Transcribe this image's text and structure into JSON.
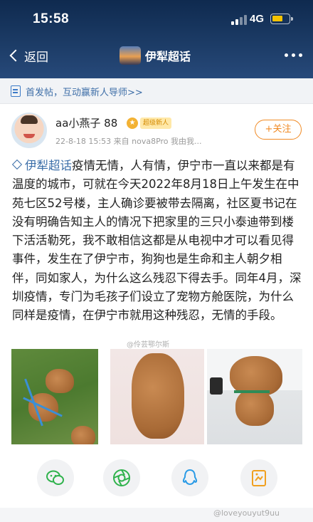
{
  "status_bar": {
    "time": "15:58",
    "network": "4G"
  },
  "nav": {
    "back_label": "返回",
    "title": "伊犁超话"
  },
  "guide": {
    "text": "首发帖，互动赢新人导师>>"
  },
  "post": {
    "username": "aa小燕子 88",
    "badge_fan": "超级新人",
    "meta": "22-8-18 15:53  来自 nova8Pro 我由我...",
    "follow_label": "+关注",
    "topic_tag": "伊犁超话",
    "body": "疫情无情，人有情，伊宁市一直以来都是有温度的城市，可就在今天2022年8月18日上午发生在中苑七区52号楼，主人确诊要被带去隔离，社区夏书记在没有明确告知主人的情况下把家里的三只小泰迪带到楼下活活勒死，我不敢相信这都是从电视中才可以看见得事件，发生在了伊宁市，狗狗也是生命和主人朝夕相伴，同如家人，为什么这么残忍下得去手。同年4月，深圳疫情，专门为毛孩子们设立了宠物方舱医院，为什么同样是疫情，在伊宁市就用这种残忍，无情的手段。",
    "image_watermark": "@伶芸鄂尔斯",
    "photos": [
      "dog-on-grass-photo",
      "dog-on-floor-photo",
      "dog-standing-photo"
    ]
  },
  "share_icons": [
    "wechat-icon",
    "moments-icon",
    "qq-icon",
    "share-card-icon"
  ],
  "footer_watermark": "@loveyouyut9uu"
}
